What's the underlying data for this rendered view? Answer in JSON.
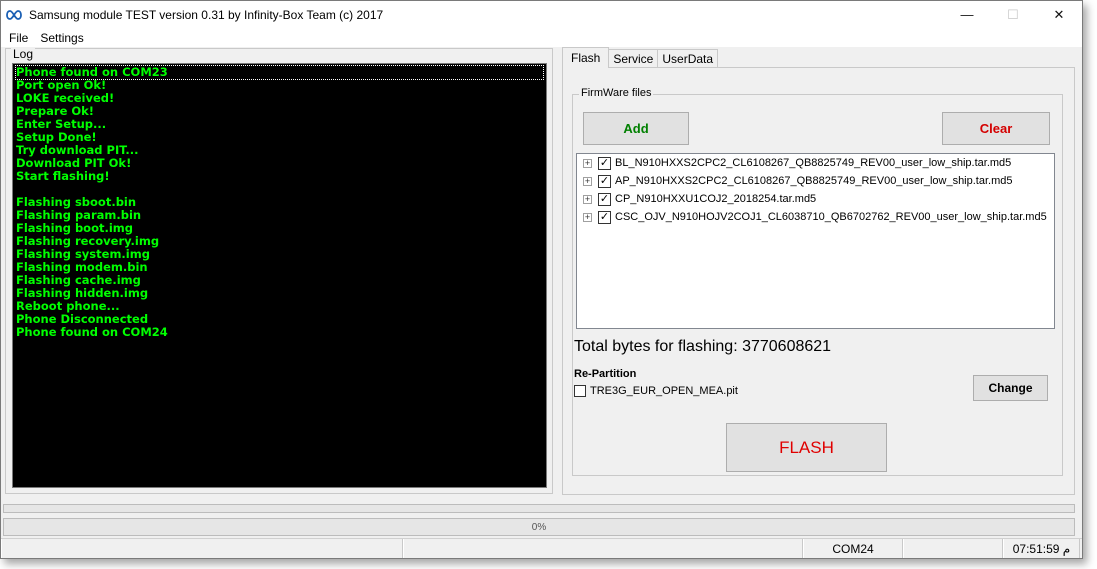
{
  "window": {
    "title": "Samsung module TEST version 0.31 by Infinity-Box Team (c) 2017",
    "icon": "infinity-icon",
    "controls": {
      "minimize": "—",
      "maximize": "☐",
      "close": "✕"
    }
  },
  "menu": {
    "items": [
      "File",
      "Settings"
    ]
  },
  "log": {
    "legend": "Log",
    "lines": [
      "Phone found on COM23",
      "Port open Ok!",
      "LOKE received!",
      "Prepare Ok!",
      "Enter Setup...",
      "Setup Done!",
      "Try download PIT...",
      "Download PIT Ok!",
      "Start flashing!",
      "",
      "Flashing sboot.bin",
      "Flashing param.bin",
      "Flashing boot.img",
      "Flashing recovery.img",
      "Flashing system.img",
      "Flashing modem.bin",
      "Flashing cache.img",
      "Flashing hidden.img",
      "Reboot phone...",
      "Phone Disconnected",
      "Phone found on COM24"
    ],
    "text_color": "#00ff00"
  },
  "tabs": {
    "items": [
      "Flash",
      "Service",
      "UserData"
    ],
    "active": "Flash"
  },
  "flash": {
    "firmware_legend": "FirmWare files",
    "add_label": "Add",
    "clear_label": "Clear",
    "files": [
      {
        "name": "BL_N910HXXS2CPC2_CL6108267_QB8825749_REV00_user_low_ship.tar.md5",
        "checked": true
      },
      {
        "name": "AP_N910HXXS2CPC2_CL6108267_QB8825749_REV00_user_low_ship.tar.md5",
        "checked": true
      },
      {
        "name": "CP_N910HXXU1COJ2_2018254.tar.md5",
        "checked": true
      },
      {
        "name": "CSC_OJV_N910HOJV2COJ1_CL6038710_QB6702762_REV00_user_low_ship.tar.md5",
        "checked": true
      }
    ],
    "expander": "+",
    "check_mark": "✓",
    "total_label": "Total bytes for flashing: 3770608621",
    "repartition_label": "Re-Partition",
    "pit_file": "TRE3G_EUR_OPEN_MEA.pit",
    "change_label": "Change",
    "flash_label": "FLASH"
  },
  "progress": {
    "top_value": 0,
    "bottom_value": 0,
    "bottom_text": "0%"
  },
  "status": {
    "port": "COM24",
    "time": "07:51:59 م"
  }
}
